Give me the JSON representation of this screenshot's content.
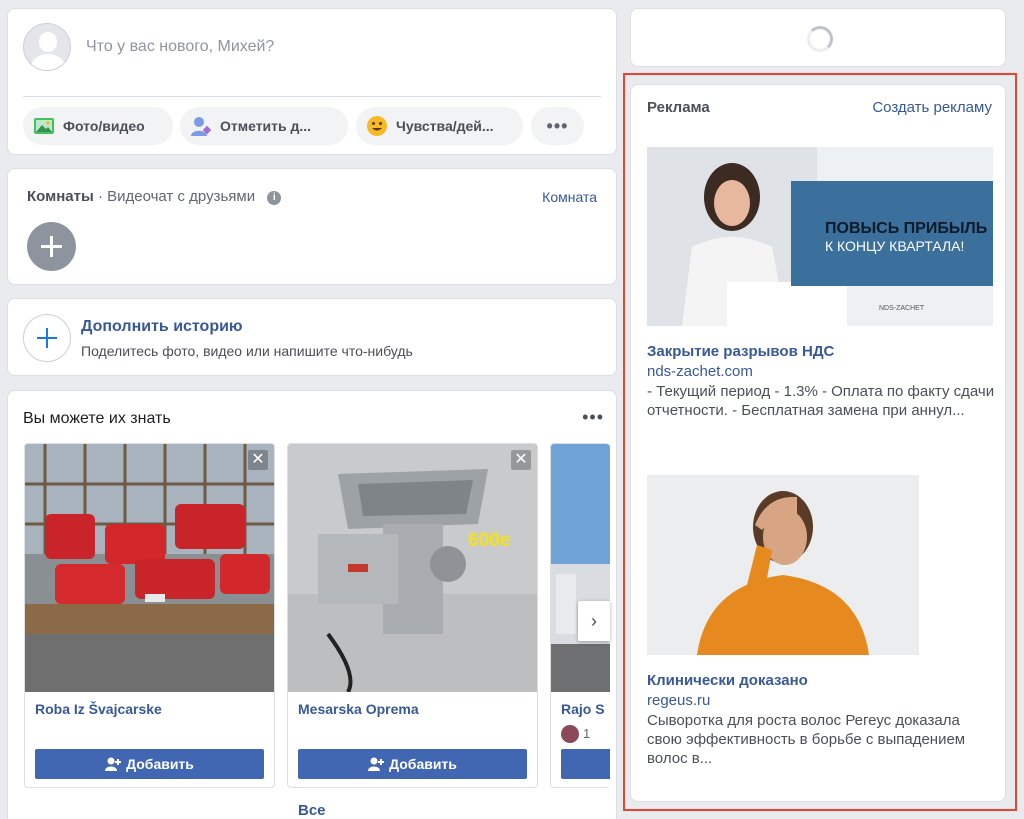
{
  "composer": {
    "prompt": "Что у вас нового, Михей?",
    "actions": [
      {
        "label": "Фото/видео",
        "icon": "photo-icon"
      },
      {
        "label": "Отметить д...",
        "icon": "tag-friends-icon"
      },
      {
        "label": "Чувства/дей...",
        "icon": "feeling-icon"
      },
      {
        "label": "•••",
        "icon": "more-icon"
      }
    ]
  },
  "rooms": {
    "title": "Комнаты",
    "subtitle": "· Видеочат с друзьями",
    "link": "Комната"
  },
  "story": {
    "title": "Дополнить историю",
    "subtitle": "Поделитесь фото, видео или напишите что-нибудь"
  },
  "pymk": {
    "title": "Вы можете их знать",
    "more": "•••",
    "add_label": "Добавить",
    "all_link": "Все",
    "cards": [
      {
        "name": "Roba Iz Švajcarske"
      },
      {
        "name": "Mesarska Oprema",
        "price_tag": "600e"
      },
      {
        "name": "Rajo S",
        "mutual": "1"
      }
    ]
  },
  "ads": {
    "title": "Реклама",
    "create_link": "Создать рекламу",
    "items": [
      {
        "headline": "Закрытие разрывов НДС",
        "domain": "nds-zachet.com",
        "text": "- Текущий период - 1.3% - Оплата по факту сдачи отчетности. - Бесплатная замена при аннул...",
        "banner_line1": "ПОВЫСЬ ПРИБЫЛЬ",
        "banner_line2": "К КОНЦУ КВАРТАЛА!",
        "banner_logo": "NDS-ZACHET"
      },
      {
        "headline": "Клинически доказано",
        "domain": "regeus.ru",
        "text": "Сыворотка для роста волос Регеус доказала свою эффективность в борьбе с выпадением волос в..."
      }
    ]
  },
  "colors": {
    "link": "#385898",
    "button": "#4267b2",
    "highlight": "#e8442f",
    "background": "#e9ebee"
  }
}
